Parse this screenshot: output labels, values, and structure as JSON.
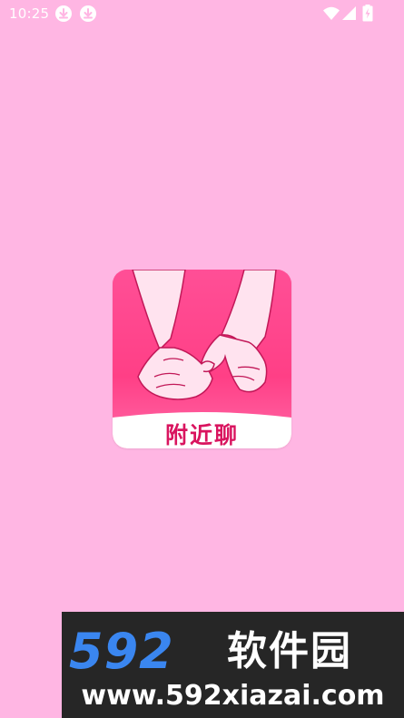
{
  "status_bar": {
    "time": "10:25",
    "icons": [
      "download-icon",
      "download-icon",
      "wifi-icon",
      "signal-icon",
      "battery-icon"
    ]
  },
  "app": {
    "logo_text": "附近聊",
    "background_color": "#ffb6e3",
    "logo_color": "#ff5a9c"
  },
  "watermark": {
    "brand_number": "592",
    "brand_text": "软件园",
    "url": "www.592xiazai.com"
  }
}
